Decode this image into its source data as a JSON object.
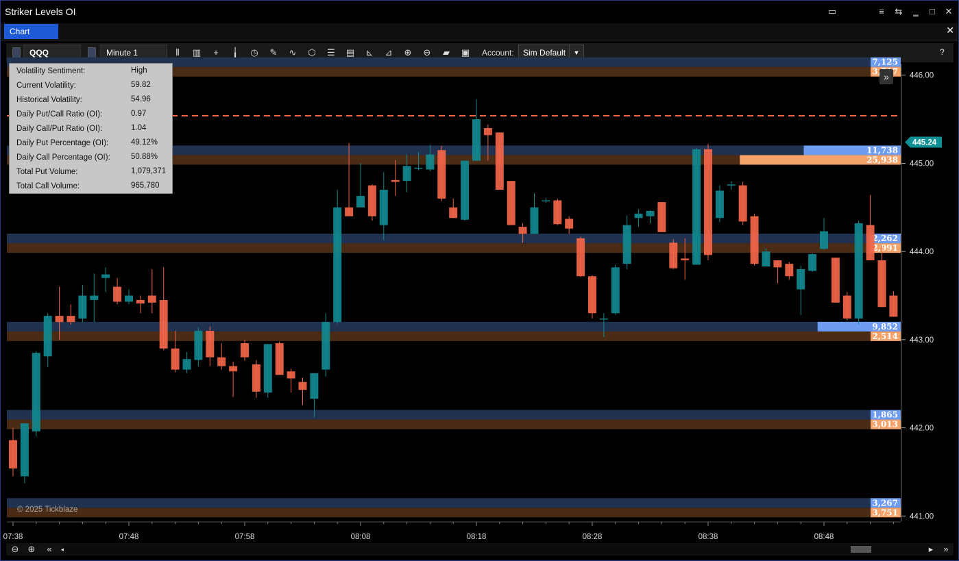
{
  "window": {
    "title": "Striker Levels OI"
  },
  "tabs": [
    {
      "label": "Chart"
    }
  ],
  "toolbar": {
    "instrument": "QQQ",
    "timeframe": "Minute 1",
    "account_label": "Account:",
    "account_value": "Sim Default",
    "icons": [
      "bar-type-icon",
      "data-series-icon",
      "crosshair-icon",
      "candlestick-icon",
      "clock-icon",
      "drawing-pencil-icon",
      "indicator-icon",
      "strategy-cube-icon",
      "list-icon",
      "report-icon",
      "axis-icon",
      "axis-alt-icon",
      "zoom-in-icon",
      "zoom-out-icon",
      "folder-icon",
      "save-icon"
    ],
    "help": "?"
  },
  "info_panel": [
    {
      "k": "Volatility Sentiment:",
      "v": "High"
    },
    {
      "k": "Current Volatility:",
      "v": "59.82"
    },
    {
      "k": "Historical Volatility:",
      "v": "54.96"
    },
    {
      "k": "Daily Put/Call Ratio (OI):",
      "v": "0.97"
    },
    {
      "k": "Daily Call/Put Ratio (OI):",
      "v": "1.04"
    },
    {
      "k": "Daily Put Percentage (OI):",
      "v": "49.12%"
    },
    {
      "k": "Daily Call Percentage (OI):",
      "v": "50.88%"
    },
    {
      "k": "Total Put Volume:",
      "v": "1,079,371"
    },
    {
      "k": "Total Call Volume:",
      "v": "965,780"
    }
  ],
  "copyright": "© 2025 Tickblaze",
  "chart_data": {
    "type": "candlestick",
    "symbol": "QQQ",
    "interval": "Minute 1",
    "ylim": [
      440.94,
      446.13
    ],
    "y_ticks": [
      "446.00",
      "445.00",
      "444.00",
      "443.00",
      "442.00",
      "441.00"
    ],
    "x_ticks": [
      "07:38",
      "07:48",
      "07:58",
      "08:08",
      "08:18",
      "08:28",
      "08:38",
      "08:48"
    ],
    "last_price": "445.24",
    "dashed_line_price": 445.54,
    "colors": {
      "up": "#11898f",
      "down": "#f26549",
      "call_band": "#20324f",
      "put_band": "#4a2b16",
      "call_label": "#6e9cf1",
      "put_label": "#f5a36b",
      "price_tag": "#0e8f93",
      "dashed": "#f26549"
    },
    "levels": [
      {
        "price": 446.0,
        "call_label": "7,125",
        "put_label": "3,717",
        "call_frac": 0.02,
        "put_frac": 0.02
      },
      {
        "price": 445.0,
        "call_label": "11,738",
        "put_label": "25,938",
        "call_frac": 0.07,
        "put_frac": 0.15
      },
      {
        "price": 444.0,
        "call_label": "2,262",
        "put_label": "2,991",
        "call_frac": 0.01,
        "put_frac": 0.02
      },
      {
        "price": 443.0,
        "call_label": "9,852",
        "put_label": "2,514",
        "call_frac": 0.06,
        "put_frac": 0.01
      },
      {
        "price": 442.0,
        "call_label": "1,865",
        "put_label": "3,013",
        "call_frac": 0.01,
        "put_frac": 0.02
      },
      {
        "price": 441.0,
        "call_label": "3,267",
        "put_label": "3,751",
        "call_frac": 0.02,
        "put_frac": 0.02
      }
    ],
    "candles": [
      {
        "t": "07:38",
        "o": 441.86,
        "h": 442.0,
        "l": 441.45,
        "c": 441.54
      },
      {
        "t": "07:39",
        "o": 441.45,
        "h": 442.05,
        "l": 441.37,
        "c": 442.05
      },
      {
        "t": "07:40",
        "o": 441.96,
        "h": 442.87,
        "l": 441.9,
        "c": 442.85
      },
      {
        "t": "07:41",
        "o": 442.81,
        "h": 443.3,
        "l": 442.69,
        "c": 443.27
      },
      {
        "t": "07:42",
        "o": 443.27,
        "h": 443.6,
        "l": 443.0,
        "c": 443.2
      },
      {
        "t": "07:43",
        "o": 443.27,
        "h": 443.4,
        "l": 443.17,
        "c": 443.2
      },
      {
        "t": "07:44",
        "o": 443.24,
        "h": 443.62,
        "l": 443.2,
        "c": 443.5
      },
      {
        "t": "07:45",
        "o": 443.45,
        "h": 443.75,
        "l": 443.2,
        "c": 443.5
      },
      {
        "t": "07:46",
        "o": 443.7,
        "h": 443.82,
        "l": 443.54,
        "c": 443.74
      },
      {
        "t": "07:47",
        "o": 443.6,
        "h": 443.7,
        "l": 443.4,
        "c": 443.43
      },
      {
        "t": "07:48",
        "o": 443.43,
        "h": 443.57,
        "l": 443.4,
        "c": 443.5
      },
      {
        "t": "07:49",
        "o": 443.45,
        "h": 443.5,
        "l": 443.3,
        "c": 443.41
      },
      {
        "t": "07:50",
        "o": 443.5,
        "h": 443.8,
        "l": 443.3,
        "c": 443.42
      },
      {
        "t": "07:51",
        "o": 443.45,
        "h": 443.82,
        "l": 442.88,
        "c": 442.9
      },
      {
        "t": "07:52",
        "o": 442.9,
        "h": 443.1,
        "l": 442.63,
        "c": 442.66
      },
      {
        "t": "07:53",
        "o": 442.66,
        "h": 442.86,
        "l": 442.62,
        "c": 442.78
      },
      {
        "t": "07:54",
        "o": 442.77,
        "h": 443.14,
        "l": 442.7,
        "c": 443.1
      },
      {
        "t": "07:55",
        "o": 443.1,
        "h": 443.15,
        "l": 442.7,
        "c": 442.8
      },
      {
        "t": "07:56",
        "o": 442.8,
        "h": 442.96,
        "l": 442.66,
        "c": 442.7
      },
      {
        "t": "07:57",
        "o": 442.7,
        "h": 442.75,
        "l": 442.35,
        "c": 442.64
      },
      {
        "t": "07:58",
        "o": 442.96,
        "h": 443.0,
        "l": 442.76,
        "c": 442.8
      },
      {
        "t": "07:59",
        "o": 442.72,
        "h": 442.77,
        "l": 442.34,
        "c": 442.41
      },
      {
        "t": "08:00",
        "o": 442.4,
        "h": 442.95,
        "l": 442.34,
        "c": 442.95
      },
      {
        "t": "08:01",
        "o": 442.96,
        "h": 442.98,
        "l": 442.6,
        "c": 442.6
      },
      {
        "t": "08:02",
        "o": 442.64,
        "h": 442.67,
        "l": 442.4,
        "c": 442.56
      },
      {
        "t": "08:03",
        "o": 442.52,
        "h": 442.57,
        "l": 442.26,
        "c": 442.43
      },
      {
        "t": "08:04",
        "o": 442.33,
        "h": 442.62,
        "l": 442.12,
        "c": 442.62
      },
      {
        "t": "08:05",
        "o": 442.66,
        "h": 443.3,
        "l": 442.58,
        "c": 443.2
      },
      {
        "t": "08:06",
        "o": 443.2,
        "h": 444.7,
        "l": 443.18,
        "c": 444.5
      },
      {
        "t": "08:07",
        "o": 444.5,
        "h": 445.23,
        "l": 444.43,
        "c": 444.4
      },
      {
        "t": "08:08",
        "o": 444.5,
        "h": 445.0,
        "l": 444.55,
        "c": 444.63
      },
      {
        "t": "08:09",
        "o": 444.75,
        "h": 444.76,
        "l": 444.35,
        "c": 444.4
      },
      {
        "t": "08:10",
        "o": 444.3,
        "h": 444.9,
        "l": 444.13,
        "c": 444.7
      },
      {
        "t": "08:11",
        "o": 444.81,
        "h": 445.04,
        "l": 444.63,
        "c": 444.79
      },
      {
        "t": "08:12",
        "o": 444.8,
        "h": 445.1,
        "l": 444.67,
        "c": 444.97
      },
      {
        "t": "08:13",
        "o": 444.95,
        "h": 445.13,
        "l": 444.92,
        "c": 444.95
      },
      {
        "t": "08:14",
        "o": 444.93,
        "h": 445.21,
        "l": 444.91,
        "c": 445.1
      },
      {
        "t": "08:15",
        "o": 445.15,
        "h": 445.2,
        "l": 444.57,
        "c": 444.6
      },
      {
        "t": "08:16",
        "o": 444.5,
        "h": 444.6,
        "l": 444.38,
        "c": 444.38
      },
      {
        "t": "08:17",
        "o": 444.36,
        "h": 445.0,
        "l": 444.35,
        "c": 445.03
      },
      {
        "t": "08:18",
        "o": 445.03,
        "h": 445.73,
        "l": 445.03,
        "c": 445.5
      },
      {
        "t": "08:19",
        "o": 445.4,
        "h": 445.44,
        "l": 445.03,
        "c": 445.32
      },
      {
        "t": "08:20",
        "o": 445.35,
        "h": 445.35,
        "l": 444.8,
        "c": 444.7
      },
      {
        "t": "08:21",
        "o": 444.8,
        "h": 444.8,
        "l": 444.3,
        "c": 444.3
      },
      {
        "t": "08:22",
        "o": 444.28,
        "h": 444.32,
        "l": 444.1,
        "c": 444.2
      },
      {
        "t": "08:23",
        "o": 444.2,
        "h": 444.66,
        "l": 444.2,
        "c": 444.5
      },
      {
        "t": "08:24",
        "o": 444.58,
        "h": 444.61,
        "l": 444.55,
        "c": 444.58
      },
      {
        "t": "08:25",
        "o": 444.58,
        "h": 444.6,
        "l": 444.3,
        "c": 444.31
      },
      {
        "t": "08:26",
        "o": 444.37,
        "h": 444.4,
        "l": 444.2,
        "c": 444.26
      },
      {
        "t": "08:27",
        "o": 444.15,
        "h": 444.17,
        "l": 443.71,
        "c": 443.72
      },
      {
        "t": "08:28",
        "o": 443.72,
        "h": 443.73,
        "l": 443.24,
        "c": 443.3
      },
      {
        "t": "08:29",
        "o": 443.24,
        "h": 443.3,
        "l": 443.03,
        "c": 443.24
      },
      {
        "t": "08:30",
        "o": 443.3,
        "h": 443.85,
        "l": 443.28,
        "c": 443.82
      },
      {
        "t": "08:31",
        "o": 443.86,
        "h": 444.41,
        "l": 443.8,
        "c": 444.3
      },
      {
        "t": "08:32",
        "o": 444.38,
        "h": 444.48,
        "l": 444.28,
        "c": 444.43
      },
      {
        "t": "08:33",
        "o": 444.4,
        "h": 444.47,
        "l": 444.32,
        "c": 444.46
      },
      {
        "t": "08:34",
        "o": 444.56,
        "h": 444.56,
        "l": 444.22,
        "c": 444.22
      },
      {
        "t": "08:35",
        "o": 444.1,
        "h": 444.14,
        "l": 443.8,
        "c": 443.81
      },
      {
        "t": "08:36",
        "o": 443.92,
        "h": 444.15,
        "l": 443.68,
        "c": 443.9
      },
      {
        "t": "08:37",
        "o": 443.85,
        "h": 445.18,
        "l": 443.85,
        "c": 445.16
      },
      {
        "t": "08:38",
        "o": 445.16,
        "h": 445.22,
        "l": 443.9,
        "c": 443.96
      },
      {
        "t": "08:39",
        "o": 444.38,
        "h": 444.75,
        "l": 444.33,
        "c": 444.69
      },
      {
        "t": "08:40",
        "o": 444.76,
        "h": 444.8,
        "l": 444.7,
        "c": 444.76
      },
      {
        "t": "08:41",
        "o": 444.75,
        "h": 444.79,
        "l": 444.3,
        "c": 444.34
      },
      {
        "t": "08:42",
        "o": 444.4,
        "h": 444.43,
        "l": 443.84,
        "c": 443.86
      },
      {
        "t": "08:43",
        "o": 443.83,
        "h": 444.04,
        "l": 443.84,
        "c": 444.0
      },
      {
        "t": "08:44",
        "o": 443.9,
        "h": 443.9,
        "l": 443.64,
        "c": 443.82
      },
      {
        "t": "08:45",
        "o": 443.86,
        "h": 443.88,
        "l": 443.68,
        "c": 443.72
      },
      {
        "t": "08:46",
        "o": 443.57,
        "h": 443.84,
        "l": 443.28,
        "c": 443.8
      },
      {
        "t": "08:47",
        "o": 443.78,
        "h": 443.98,
        "l": 443.77,
        "c": 443.97
      },
      {
        "t": "08:48",
        "o": 444.03,
        "h": 444.38,
        "l": 444.02,
        "c": 444.23
      },
      {
        "t": "08:49",
        "o": 443.93,
        "h": 443.93,
        "l": 443.42,
        "c": 443.42
      },
      {
        "t": "08:50",
        "o": 443.5,
        "h": 443.54,
        "l": 443.22,
        "c": 443.24
      },
      {
        "t": "08:51",
        "o": 443.24,
        "h": 444.35,
        "l": 443.17,
        "c": 444.32
      },
      {
        "t": "08:52",
        "o": 444.3,
        "h": 444.64,
        "l": 443.9,
        "c": 443.9
      },
      {
        "t": "08:53",
        "o": 443.9,
        "h": 444.07,
        "l": 443.37,
        "c": 443.37
      },
      {
        "t": "08:54",
        "o": 443.5,
        "h": 443.55,
        "l": 443.26,
        "c": 443.26
      }
    ]
  }
}
